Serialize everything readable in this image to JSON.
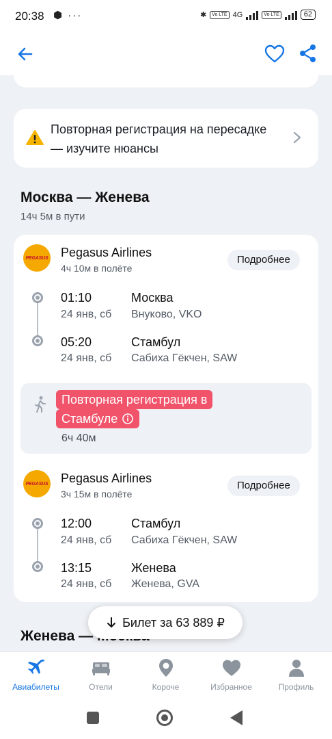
{
  "status_bar": {
    "time": "20:38",
    "left_icons": "⬢ ···",
    "volte1": "Vo LTE",
    "net": "4G",
    "volte2": "Vo LTE",
    "battery": "62"
  },
  "notice": {
    "text": "Повторная регистрация на пересадке — изучите нюансы"
  },
  "route": {
    "title": "Москва — Женева",
    "duration": "14ч 5м в пути"
  },
  "segments": [
    {
      "airline": "Pegasus Airlines",
      "logo_text": "PEGASUS",
      "flight_time": "4ч 10м в полёте",
      "more_label": "Подробнее",
      "departure": {
        "time": "01:10",
        "date": "24 янв, сб",
        "city": "Москва",
        "airport": "Внуково, VKO"
      },
      "arrival": {
        "time": "05:20",
        "date": "24 янв, сб",
        "city": "Стамбул",
        "airport": "Сабиха Гёкчен, SAW"
      }
    },
    {
      "airline": "Pegasus Airlines",
      "logo_text": "PEGASUS",
      "flight_time": "3ч 15м в полёте",
      "more_label": "Подробнее",
      "departure": {
        "time": "12:00",
        "date": "24 янв, сб",
        "city": "Стамбул",
        "airport": "Сабиха Гёкчен, SAW"
      },
      "arrival": {
        "time": "13:15",
        "date": "24 янв, сб",
        "city": "Женева",
        "airport": "Женева, GVA"
      }
    }
  ],
  "transfer": {
    "line1": "Повторная регистрация в",
    "line2": "Стамбуле",
    "duration": "6ч 40м"
  },
  "return_route": {
    "title": "Женева — Москва"
  },
  "ticket_button": {
    "label": "Билет за 63 889 ₽"
  },
  "bottom_nav": [
    {
      "label": "Авиабилеты",
      "icon": "plane-icon",
      "active": true
    },
    {
      "label": "Отели",
      "icon": "bed-icon",
      "active": false
    },
    {
      "label": "Короче",
      "icon": "pin-icon",
      "active": false
    },
    {
      "label": "Избранное",
      "icon": "heart-icon",
      "active": false
    },
    {
      "label": "Профиль",
      "icon": "person-icon",
      "active": false
    }
  ],
  "colors": {
    "accent": "#1776e5",
    "alert": "#f0536a",
    "logo_bg": "#f5a800",
    "background": "#eef1f5"
  }
}
